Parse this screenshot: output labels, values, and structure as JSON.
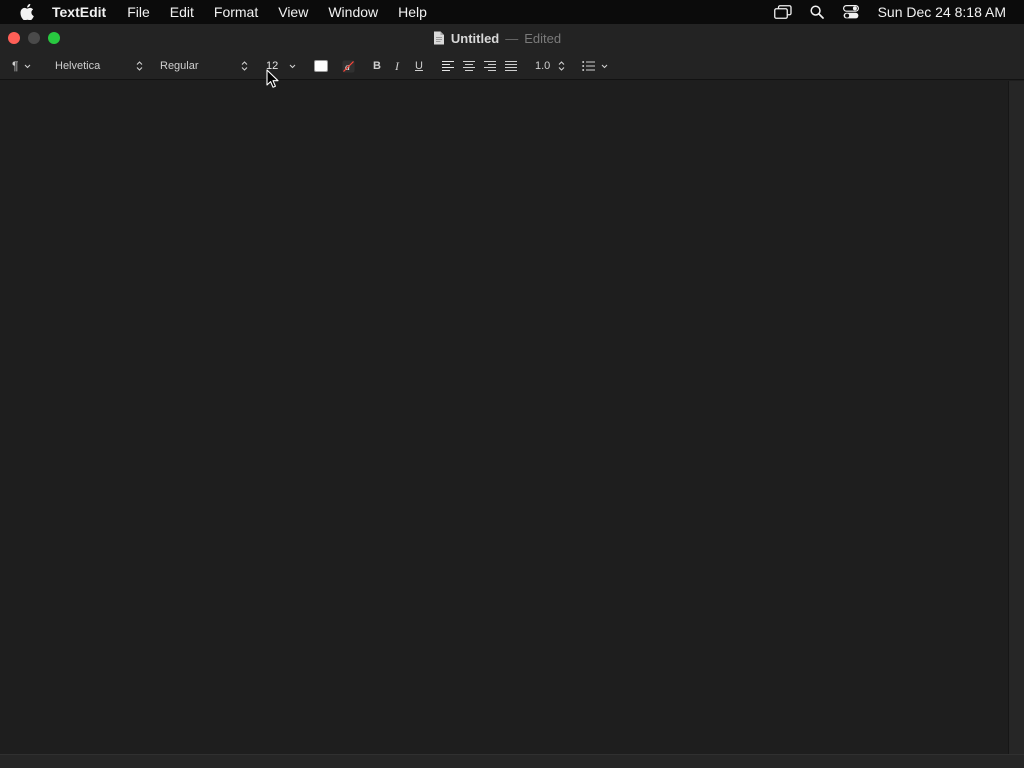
{
  "menubar": {
    "apple_icon": "apple-logo-icon",
    "app_name": "TextEdit",
    "menus": [
      "File",
      "Edit",
      "Format",
      "View",
      "Window",
      "Help"
    ],
    "status_icons": [
      "screen-mirroring-icon",
      "spotlight-search-icon",
      "control-center-icon"
    ],
    "clock": "Sun Dec 24  8:18 AM"
  },
  "window": {
    "title": "Untitled",
    "separator": "—",
    "state": "Edited"
  },
  "toolbar": {
    "paragraph_style_icon": "paragraph-icon",
    "font_family": "Helvetica",
    "typeface": "Regular",
    "font_size": "12",
    "text_color": "#ffffff",
    "bold_label": "B",
    "italic_label": "I",
    "underline_label": "U",
    "line_spacing": "1.0",
    "list_icon": "bulleted-list-icon"
  },
  "colors": {
    "menubar_bg": "#0b0b0b",
    "window_bg": "#232323",
    "document_bg": "#1e1e1e",
    "close_button": "#ff5f57",
    "zoom_button": "#28c840"
  }
}
